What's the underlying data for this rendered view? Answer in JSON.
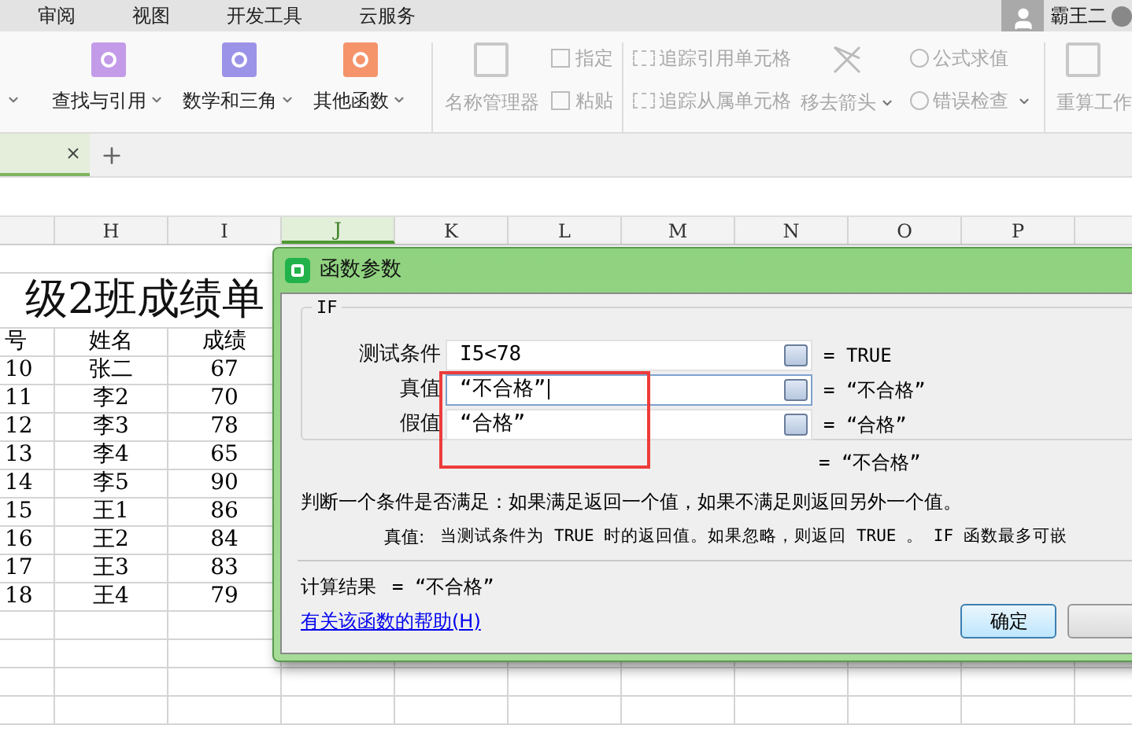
{
  "menu_tabs": [
    "审阅",
    "视图",
    "开发工具",
    "云服务"
  ],
  "user": {
    "name": "霸王二"
  },
  "ribbon": {
    "function_buttons": [
      {
        "kind": "text",
        "dropdown": true
      },
      {
        "kind": "icon",
        "label": "查找与引用",
        "dropdown": true,
        "color": "#c39be9"
      },
      {
        "kind": "icon",
        "label": "数学和三角",
        "dropdown": true,
        "color": "#9b93e8"
      },
      {
        "kind": "icon",
        "label": "其他函数",
        "dropdown": true,
        "color": "#f5946b"
      }
    ],
    "name_manager": {
      "label": "名称管理器",
      "disabled": true
    },
    "name_tools": [
      {
        "label": "指定",
        "disabled": true
      },
      {
        "label": "粘贴",
        "disabled": true
      }
    ],
    "audit_tools": [
      {
        "label": "追踪引用单元格",
        "disabled": true
      },
      {
        "label": "追踪从属单元格",
        "disabled": true
      }
    ],
    "remove_arrows": {
      "label": "移去箭头",
      "dropdown": true,
      "disabled": true
    },
    "eval_tools": [
      {
        "label": "公式求值",
        "dropdown": false,
        "disabled": true
      },
      {
        "label": "错误检查",
        "dropdown": true,
        "disabled": true
      }
    ],
    "recalc": {
      "label": "重算工作",
      "disabled": true
    }
  },
  "sheet": {
    "columns": [
      {
        "selected": false
      },
      {
        "label": "H",
        "selected": false
      },
      {
        "label": "I",
        "selected": false
      },
      {
        "label": "J",
        "selected": true
      },
      {
        "label": "K",
        "selected": false
      },
      {
        "label": "L",
        "selected": false
      },
      {
        "label": "M",
        "selected": false
      },
      {
        "label": "N",
        "selected": false
      },
      {
        "label": "O",
        "selected": false
      },
      {
        "label": "P",
        "selected": false
      }
    ],
    "title": "级2班成绩单",
    "rows": [
      [
        "号",
        "姓名",
        "成绩"
      ],
      [
        "10",
        "张二",
        "67"
      ],
      [
        "11",
        "李2",
        "70"
      ],
      [
        "12",
        "李3",
        "78"
      ],
      [
        "13",
        "李4",
        "65"
      ],
      [
        "14",
        "李5",
        "90"
      ],
      [
        "15",
        "王1",
        "86"
      ],
      [
        "16",
        "王2",
        "84"
      ],
      [
        "17",
        "王3",
        "83"
      ],
      [
        "18",
        "王4",
        "79"
      ]
    ]
  },
  "dialog": {
    "title": "函数参数",
    "function": "IF",
    "args": [
      {
        "label": "测试条件",
        "value": "I5<78",
        "result": "= TRUE",
        "focused": false
      },
      {
        "label": "真值",
        "value": "“不合格”",
        "result": "= “不合格”",
        "focused": true
      },
      {
        "label": "假值",
        "value": "“合格”",
        "result": "= “合格”",
        "focused": false
      }
    ],
    "result": "= “不合格”",
    "description": "判断一个条件是否满足：如果满足返回一个值，如果不满足则返回另外一个值。",
    "arg_help": {
      "label": "真值:",
      "text": "当测试条件为 TRUE 时的返回值。如果忽略，则返回 TRUE 。 IF 函数最多可嵌"
    },
    "calc_label": "计算结果",
    "calc_value": "= “不合格”",
    "help_link": "有关该函数的帮助(H)",
    "ok": "确定"
  }
}
